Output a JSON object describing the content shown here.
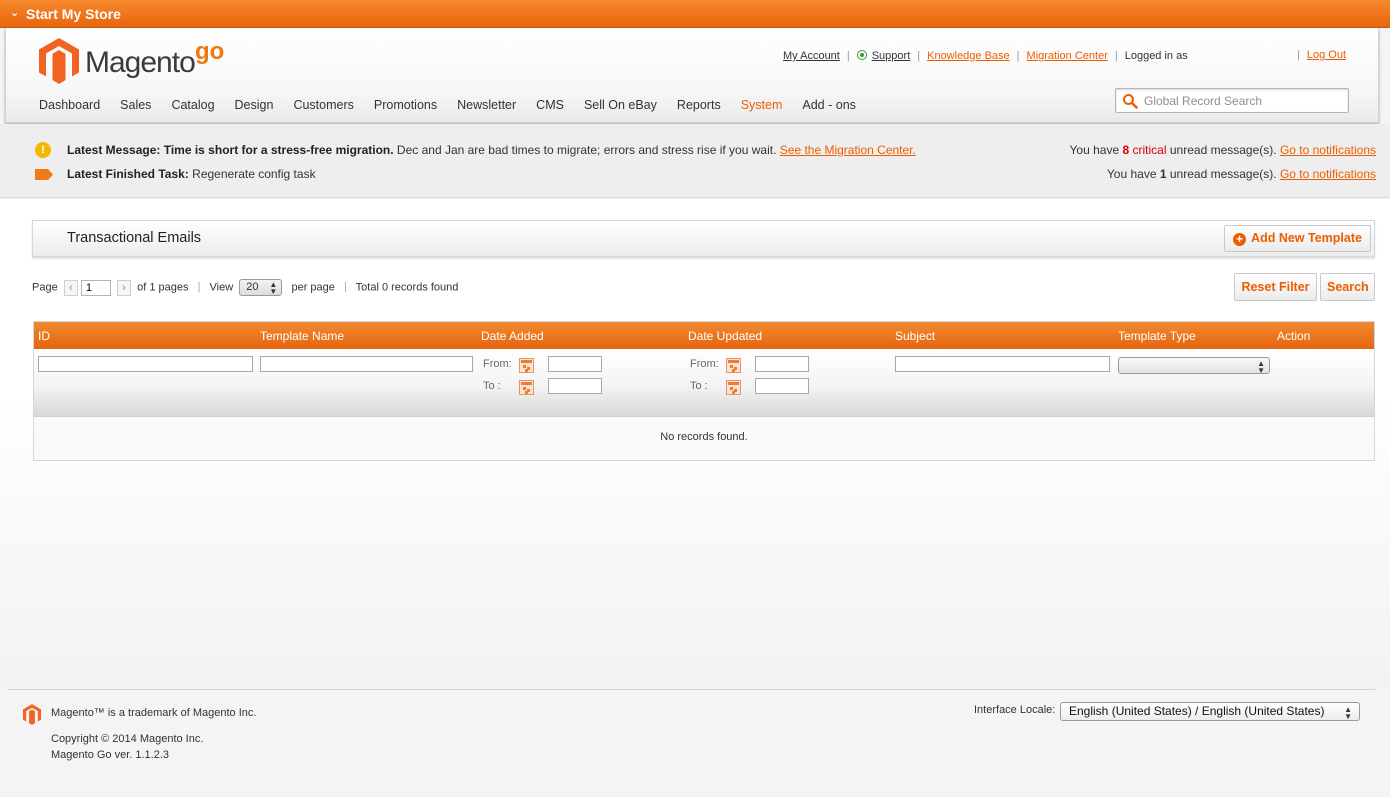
{
  "topbar": {
    "title": "Start My Store"
  },
  "header": {
    "brand": "Magento",
    "brand_suffix": "go",
    "links": {
      "my_account": "My Account",
      "support": "Support",
      "knowledge_base": "Knowledge Base",
      "migration_center": "Migration Center",
      "logged_in": "Logged in as",
      "log_out": "Log Out"
    },
    "nav": [
      "Dashboard",
      "Sales",
      "Catalog",
      "Design",
      "Customers",
      "Promotions",
      "Newsletter",
      "CMS",
      "Sell On eBay",
      "Reports",
      "System",
      "Add - ons"
    ],
    "active_nav": "System",
    "search_placeholder": "Global Record Search"
  },
  "messages": {
    "latest_label": "Latest Message:",
    "latest_bold": "Time is short for a stress-free migration.",
    "latest_text": "Dec and Jan are bad times to migrate; errors and stress rise if you wait.",
    "latest_link": "See the Migration Center.",
    "task_label": "Latest Finished Task:",
    "task_text": "Regenerate config task",
    "critical_prefix": "You have",
    "critical_count": "8",
    "critical_word": "critical",
    "critical_suffix": "unread message(s).",
    "unread_prefix": "You have",
    "unread_count": "1",
    "unread_suffix": "unread message(s).",
    "goto_link": "Go to notifications"
  },
  "page": {
    "title": "Transactional Emails",
    "add_button": "Add New Template"
  },
  "pager": {
    "page_label": "Page",
    "page_value": "1",
    "of_pages": "of 1 pages",
    "view_label": "View",
    "per_page_value": "20",
    "per_page_label": "per page",
    "total": "Total 0 records found",
    "reset_filter": "Reset Filter",
    "search": "Search"
  },
  "grid": {
    "columns": [
      "ID",
      "Template Name",
      "Date Added",
      "Date Updated",
      "Subject",
      "Template Type",
      "Action"
    ],
    "from_label": "From:",
    "to_label": "To :",
    "empty_text": "No records found."
  },
  "footer": {
    "trademark": "Magento™ is a trademark of Magento Inc.",
    "copyright": "Copyright © 2014 Magento Inc.",
    "version": "Magento Go ver. 1.1.2.3",
    "locale_label": "Interface Locale:",
    "locale_value": "English (United States) / English (United States)"
  },
  "colors": {
    "accent": "#eb5e00",
    "header_orange": "#e8650d",
    "critical": "#d40000"
  }
}
